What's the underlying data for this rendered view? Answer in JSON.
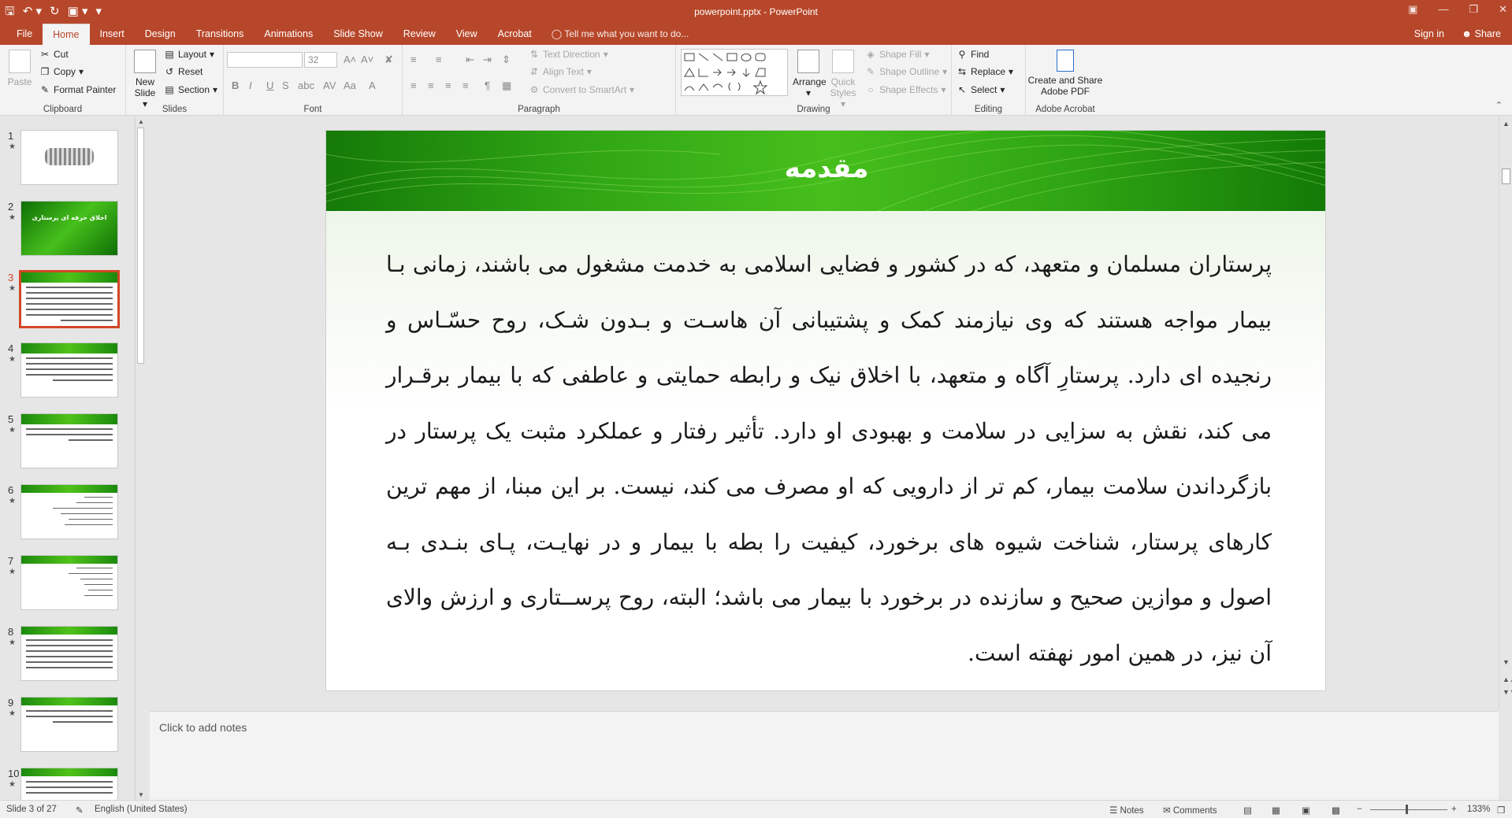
{
  "window": {
    "title": "powerpoint.pptx - PowerPoint"
  },
  "qat": {
    "save_icon": "save-icon",
    "undo_icon": "undo-icon",
    "redo_icon": "repeat-icon",
    "customize_icon": "customize-icon"
  },
  "tabs": [
    "File",
    "Home",
    "Insert",
    "Design",
    "Transitions",
    "Animations",
    "Slide Show",
    "Review",
    "View",
    "Acrobat"
  ],
  "active_tab": "Home",
  "tell_me": "Tell me what you want to do...",
  "account": {
    "sign_in": "Sign in",
    "share": "Share"
  },
  "ribbon": {
    "clipboard": {
      "label": "Clipboard",
      "paste": "Paste",
      "cut": "Cut",
      "copy": "Copy",
      "format_painter": "Format Painter"
    },
    "slides": {
      "label": "Slides",
      "new_slide_1": "New",
      "new_slide_2": "Slide",
      "layout": "Layout",
      "reset": "Reset",
      "section": "Section"
    },
    "font": {
      "label": "Font",
      "font_name": "",
      "font_size": "32"
    },
    "paragraph": {
      "label": "Paragraph",
      "text_direction": "Text Direction",
      "align_text": "Align Text",
      "convert_smartart": "Convert to SmartArt"
    },
    "drawing": {
      "label": "Drawing",
      "arrange": "Arrange",
      "quick_styles_1": "Quick",
      "quick_styles_2": "Styles",
      "shape_fill": "Shape Fill",
      "shape_outline": "Shape Outline",
      "shape_effects": "Shape Effects"
    },
    "editing": {
      "label": "Editing",
      "find": "Find",
      "replace": "Replace",
      "select": "Select"
    },
    "acrobat": {
      "label": "Adobe Acrobat",
      "create_1": "Create and Share",
      "create_2": "Adobe PDF"
    }
  },
  "thumbnails": [
    {
      "num": "1"
    },
    {
      "num": "2",
      "caption": "اخلاق حرفه ای پرستاری"
    },
    {
      "num": "3"
    },
    {
      "num": "4"
    },
    {
      "num": "5"
    },
    {
      "num": "6"
    },
    {
      "num": "7"
    },
    {
      "num": "8"
    },
    {
      "num": "9"
    },
    {
      "num": "10"
    }
  ],
  "slide": {
    "title": "مقدمه",
    "body": "پرستاران مسلمان و متعهد، که در کشور و فضایی اسلامی به خدمت مشغول می باشند، زمانی بـا بیمار مواجه هستند که وی نیازمند کمک و پشتیبانی آن هاسـت و بـدون شـک، روح حسّـاس و رنجیده ای دارد. پرستارِ آگاه و متعهد، با اخلاق نیک و رابطه حمایتی و عاطفی که با بیمار برقـرار می کند، نقش به سزایی در سلامت و بهبودی او دارد. تأثیر رفتار و عملکرد مثبت یک پرستار در بازگرداندن سلامت بیمار، کم تر از دارویی که او مصرف می کند، نیست. بر این مبنا، از مهم ترین کارهای پرستار، شناخت شیوه های برخورد، کیفیت را بطه با بیمار و در نهایـت، پـای بنـدی بـه اصول و موازین صحیح و سازنده در برخورد با بیمار می باشد؛ البته، روح پرســتاری و ارزش والای آن نیز، در همین امور نهفته است."
  },
  "notes": {
    "placeholder": "Click to add notes"
  },
  "status": {
    "slide_indicator": "Slide 3 of 27",
    "language": "English (United States)",
    "notes": "Notes",
    "comments": "Comments",
    "zoom": "133%"
  }
}
